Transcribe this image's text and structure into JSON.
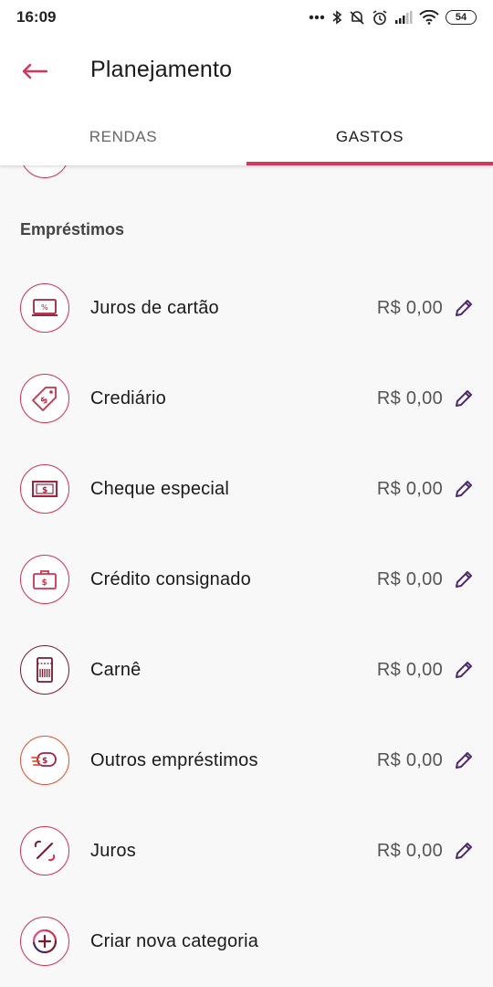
{
  "status_bar": {
    "time": "16:09",
    "battery": "54",
    "icons": [
      "dots-icon",
      "bluetooth-icon",
      "alarm-off-icon",
      "alarm-icon",
      "signal-icon",
      "wifi-icon",
      "battery-icon"
    ]
  },
  "header": {
    "title": "Planejamento",
    "back_icon": "arrow-left-icon"
  },
  "tabs": [
    {
      "label": "RENDAS",
      "active": false
    },
    {
      "label": "GASTOS",
      "active": true
    }
  ],
  "section": {
    "title": "Empréstimos",
    "items": [
      {
        "label": "Juros de cartão",
        "value": "R$ 0,00",
        "icon": "laptop-percent-icon"
      },
      {
        "label": "Crediário",
        "value": "R$ 0,00",
        "icon": "price-tag-icon"
      },
      {
        "label": "Cheque especial",
        "value": "R$ 0,00",
        "icon": "banknote-icon"
      },
      {
        "label": "Crédito consignado",
        "value": "R$ 0,00",
        "icon": "briefcase-money-icon"
      },
      {
        "label": "Carnê",
        "value": "R$ 0,00",
        "icon": "booklet-icon"
      },
      {
        "label": "Outros empréstimos",
        "value": "R$ 0,00",
        "icon": "coins-icon"
      },
      {
        "label": "Juros",
        "value": "R$ 0,00",
        "icon": "percent-icon"
      }
    ]
  },
  "add_category": {
    "label": "Criar nova categoria",
    "icon": "add-circle-icon"
  },
  "colors": {
    "accent": "#d6355f",
    "icon_border": "#d3304f",
    "edit_icon": "#4a2a6a",
    "background": "#f8f8f8"
  }
}
